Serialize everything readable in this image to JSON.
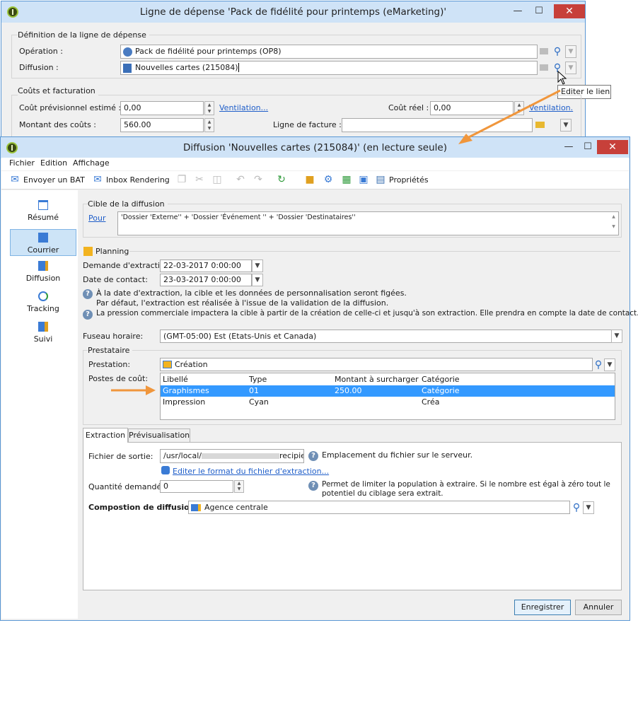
{
  "parent_window": {
    "title": "Ligne de dépense 'Pack de fidélité pour printemps (eMarketing)'",
    "section_definition": "Définition de la ligne de dépense",
    "operation_label": "Opération :",
    "operation_value": "Pack de fidélité pour printemps (OP8)",
    "diffusion_label": "Diffusion :",
    "diffusion_value": "Nouvelles cartes (215084)",
    "tooltip": "Editer le lien",
    "section_costs": "Coûts et facturation",
    "estimated_cost_label": "Coût prévisionnel estimé :",
    "estimated_cost_value": "0,00",
    "ventilation_link_1": "Ventilation...",
    "real_cost_label": "Coût réel :",
    "real_cost_value": "0,00",
    "ventilation_link_2": "Ventilation.",
    "amount_label": "Montant des coûts :",
    "amount_value": "560.00",
    "invoice_label": "Ligne de facture :",
    "invoice_value": ""
  },
  "child_window": {
    "title": "Diffusion 'Nouvelles cartes (215084)' (en lecture seule)",
    "menu": [
      "Fichier",
      "Edition",
      "Affichage"
    ],
    "toolbar": {
      "send_bat": "Envoyer un BAT",
      "inbox_rendering": "Inbox Rendering",
      "properties": "Propriétés"
    },
    "sidebar": [
      {
        "label": "Résumé",
        "icon": "summary-icon"
      },
      {
        "label": "Courrier",
        "icon": "mail-icon"
      },
      {
        "label": "Diffusion",
        "icon": "delivery-icon"
      },
      {
        "label": "Tracking",
        "icon": "tracking-icon"
      },
      {
        "label": "Suivi",
        "icon": "monitoring-icon"
      }
    ],
    "target": {
      "section": "Cible de la diffusion",
      "for_link": "Pour",
      "value": "'Dossier 'Externe'' + 'Dossier 'Événement '' + 'Dossier 'Destinataires''"
    },
    "planning": {
      "section": "Planning",
      "extraction_label": "Demande d'extraction:",
      "extraction_value": "22-03-2017 0:00:00",
      "contact_label": "Date de contact:",
      "contact_value": "23-03-2017 0:00:00",
      "info1_line1": "À la date d'extraction, la cible et les données de personnalisation seront figées.",
      "info1_line2": "Par défaut, l'extraction est réalisée à l'issue de la validation de la diffusion.",
      "info2": "La pression commerciale impactera la cible à partir de la création de celle-ci et jusqu'à son extraction. Elle prendra en compte la date de contact."
    },
    "timezone": {
      "label": "Fuseau horaire:",
      "value": "(GMT-05:00) Est (Etats-Unis et Canada)"
    },
    "provider": {
      "section": "Prestataire",
      "service_label": "Prestation:",
      "service_value": "Création",
      "cost_items_label": "Postes de coût:",
      "columns": [
        "Libellé",
        "Type",
        "Montant à surcharger",
        "Catégorie"
      ],
      "rows": [
        {
          "label": "Graphismes",
          "type": "01",
          "amount": "250.00",
          "category": "Catégorie",
          "selected": true
        },
        {
          "label": "Impression",
          "type": "Cyan",
          "amount": "",
          "category": "Créa",
          "selected": false
        }
      ]
    },
    "tabs": [
      "Extraction",
      "Prévisualisation"
    ],
    "extraction": {
      "output_file_label": "Fichier de sortie:",
      "output_file_prefix": "/usr/local/",
      "output_file_suffix": "recipient",
      "output_file_hint": "Emplacement du fichier sur le serveur.",
      "edit_format_link": "Editer le format du fichier d'extraction...",
      "quantity_label": "Quantité demandée:",
      "quantity_value": "0",
      "quantity_hint": "Permet de limiter la population à extraire. Si le nombre est égal à zéro tout le potentiel du ciblage sera extrait.",
      "composition_label": "Compostion de diffusion:",
      "composition_value": "Agence centrale"
    },
    "buttons": {
      "save": "Enregistrer",
      "cancel": "Annuler"
    }
  },
  "colors": {
    "titlebar": "#cfe3f7",
    "window_border": "#5a97d4",
    "selection": "#3399ff",
    "link": "#1f5ec9",
    "arrow": "#f0963c",
    "close_button": "#c7403a"
  }
}
